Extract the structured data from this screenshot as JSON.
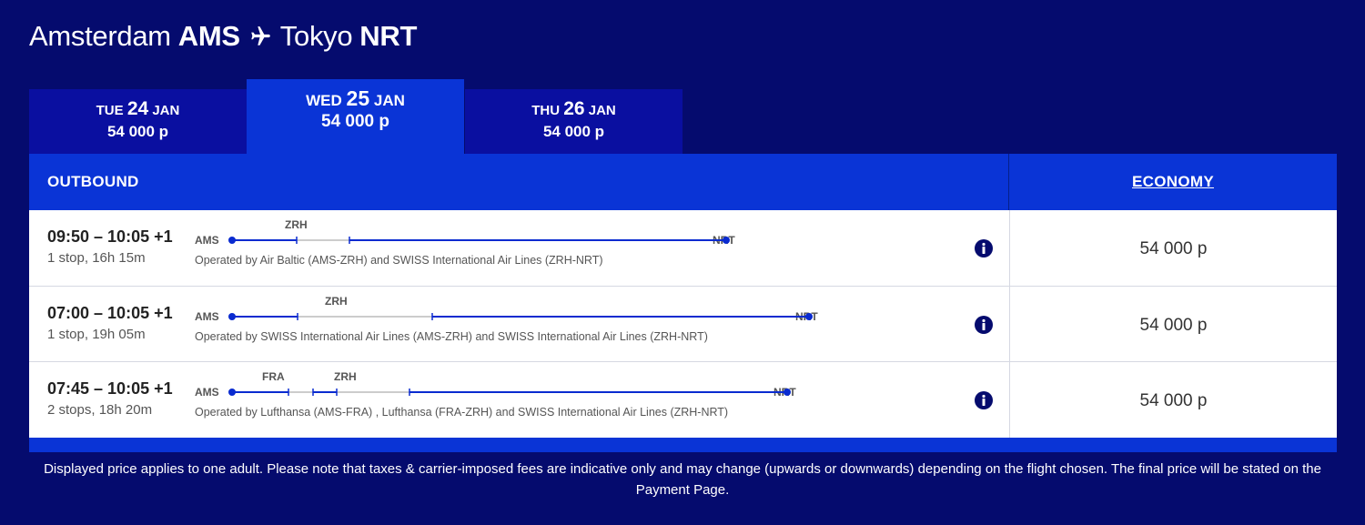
{
  "header": {
    "origin_city": "Amsterdam",
    "origin_code": "AMS",
    "destination_city": "Tokyo",
    "destination_code": "NRT",
    "plane_icon": "plane-icon"
  },
  "date_tabs": [
    {
      "weekday": "TUE",
      "day": "24",
      "month": "JAN",
      "price": "54 000 р",
      "selected": false
    },
    {
      "weekday": "WED",
      "day": "25",
      "month": "JAN",
      "price": "54 000 р",
      "selected": true
    },
    {
      "weekday": "THU",
      "day": "26",
      "month": "JAN",
      "price": "54 000 р",
      "selected": false
    }
  ],
  "table": {
    "outbound_label": "OUTBOUND",
    "economy_label": "ECONOMY"
  },
  "flights": [
    {
      "times": "09:50 – 10:05 +1",
      "stops": "1 stop, 16h 15m",
      "origin": "AMS",
      "destination": "NRT",
      "connections": [
        "ZRH"
      ],
      "operated_by": "Operated by Air Baltic (AMS-ZRH) and SWISS International Air Lines (ZRH-NRT)",
      "price": "54 000 р"
    },
    {
      "times": "07:00 – 10:05 +1",
      "stops": "1 stop, 19h 05m",
      "origin": "AMS",
      "destination": "NRT",
      "connections": [
        "ZRH"
      ],
      "operated_by": "Operated by SWISS International Air Lines (AMS-ZRH) and SWISS International Air Lines (ZRH-NRT)",
      "price": "54 000 р"
    },
    {
      "times": "07:45 – 10:05 +1",
      "stops": "2 stops, 18h 20m",
      "origin": "AMS",
      "destination": "NRT",
      "connections": [
        "FRA",
        "ZRH"
      ],
      "operated_by": "Operated by Lufthansa (AMS-FRA) , Lufthansa (FRA-ZRH) and SWISS International Air Lines (ZRH-NRT)",
      "price": "54 000 р"
    }
  ],
  "disclaimer": "Displayed price applies to one adult. Please note that taxes & carrier-imposed fees are indicative only and may change (upwards or downwards) depending on the flight chosen. The final price will be stated on the Payment Page.",
  "colors": {
    "background": "#050b6e",
    "tab_inactive": "#0a0fa0",
    "accent_blue": "#0a34d6",
    "route_line": "#0a2bd0",
    "layover_line": "#cccccc"
  }
}
